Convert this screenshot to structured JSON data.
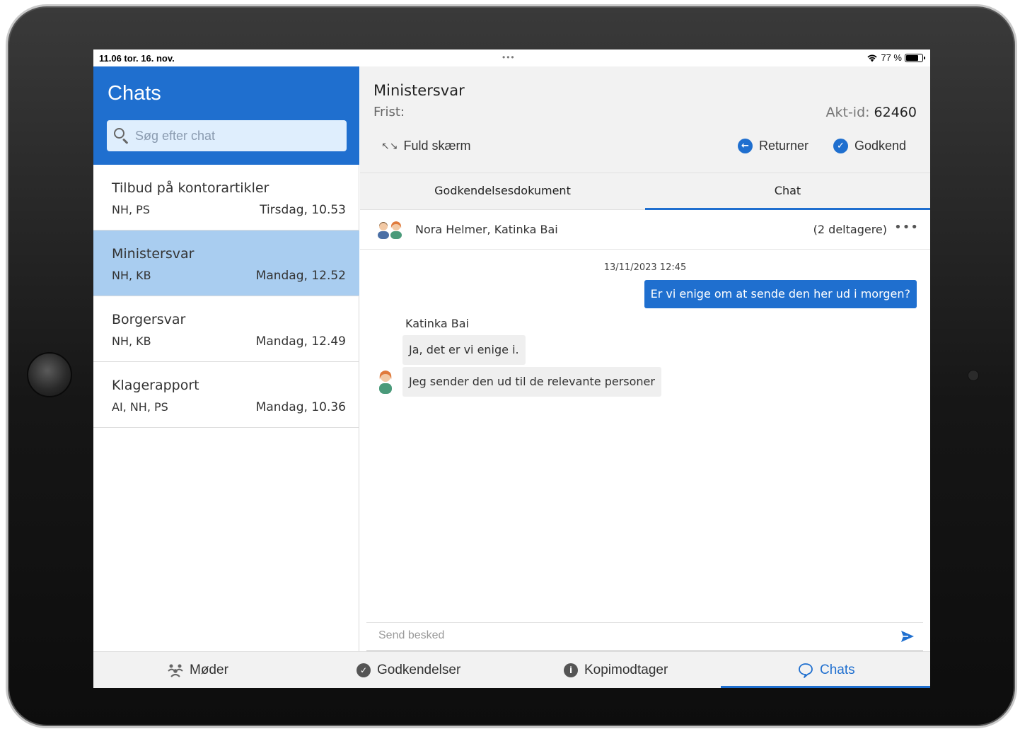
{
  "status_bar": {
    "time": "11.06  tor. 16. nov.",
    "dots": "•••",
    "battery_text": "77 %",
    "battery_level": 0.77
  },
  "sidebar": {
    "title": "Chats",
    "search_placeholder": "Søg efter chat",
    "chats": [
      {
        "title": "Tilbud på kontorartikler",
        "initials": "NH, PS",
        "time": "Tirsdag, 10.53",
        "selected": false
      },
      {
        "title": "Ministersvar",
        "initials": "NH, KB",
        "time": "Mandag, 12.52",
        "selected": true
      },
      {
        "title": "Borgersvar",
        "initials": "NH, KB",
        "time": "Mandag, 12.49",
        "selected": false
      },
      {
        "title": "Klagerapport",
        "initials": "AI, NH, PS",
        "time": "Mandag, 10.36",
        "selected": false
      }
    ]
  },
  "document": {
    "title": "Ministersvar",
    "frist_label": "Frist:",
    "akt_label": "Akt-id:",
    "akt_value": "62460"
  },
  "actions": {
    "fullscreen": "Fuld skærm",
    "return": "Returner",
    "approve": "Godkend"
  },
  "tabs": [
    {
      "label": "Godkendelsesdokument",
      "active": false
    },
    {
      "label": "Chat",
      "active": true
    }
  ],
  "chat": {
    "participants": "Nora Helmer, Katinka Bai",
    "participant_count": "(2 deltagere)",
    "more": "•••",
    "timestamp": "13/11/2023 12:45",
    "outgoing_message": "Er vi enige om at sende den her ud i morgen?",
    "sender": "Katinka Bai",
    "incoming_messages": [
      "Ja, det er vi enige i.",
      "Jeg sender den ud til de relevante personer"
    ],
    "compose_placeholder": "Send besked"
  },
  "bottom_tabs": [
    {
      "label": "Møder",
      "icon": "meetings-icon",
      "active": false
    },
    {
      "label": "Godkendelser",
      "icon": "check-circle-icon",
      "active": false
    },
    {
      "label": "Kopimodtager",
      "icon": "info-icon",
      "active": false
    },
    {
      "label": "Chats",
      "icon": "chat-bubble-icon",
      "active": true
    }
  ],
  "colors": {
    "accent": "#1f6fcf",
    "selected_row": "#a9cdf0",
    "search_bg": "#dfeefd"
  }
}
